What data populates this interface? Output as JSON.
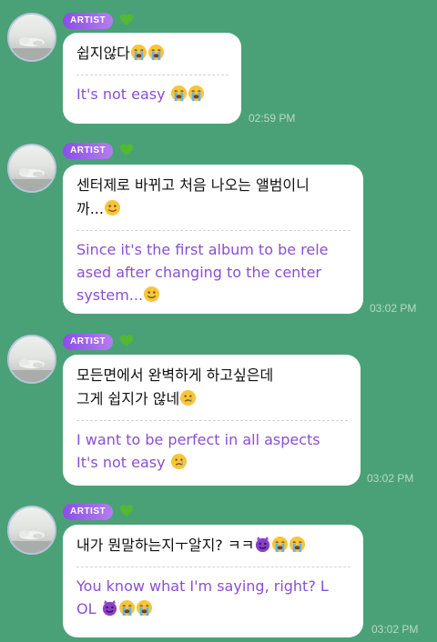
{
  "colors": {
    "background": "#4aa177",
    "bubble": "#ffffff",
    "korean_text": "#111111",
    "english_text": "#8a4fd2",
    "badge_start": "#8a4fe6",
    "badge_end": "#b57cf0",
    "timestamp": "#b9d9c8",
    "heart": "#53b832"
  },
  "messages": [
    {
      "badge": "ARTIST",
      "heart_icon": "green-heart-icon",
      "korean": "쉽지않다",
      "korean_emojis": [
        "loudly-crying-icon",
        "loudly-crying-icon"
      ],
      "english": "It's not easy",
      "english_emojis": [
        "loudly-crying-icon",
        "loudly-crying-icon"
      ],
      "time": "02:59 PM"
    },
    {
      "badge": "ARTIST",
      "heart_icon": "green-heart-icon",
      "korean": "센터제로 바뀌고 처음 나오는 앨범이니\n까...",
      "korean_emojis": [
        "smiling-face-icon"
      ],
      "english": "Since it's the first album to be rele\nased after changing to the center\nsystem...",
      "english_emojis": [
        "smiling-face-icon"
      ],
      "time": "03:02 PM"
    },
    {
      "badge": "ARTIST",
      "heart_icon": "green-heart-icon",
      "korean": "모든면에서 완벽하게 하고싶은데\n그게 쉽지가 않네",
      "korean_emojis": [
        "crying-face-icon"
      ],
      "english": "I want to be perfect in all aspects\nIt's not easy",
      "english_emojis": [
        "crying-face-icon"
      ],
      "time": "03:02 PM"
    },
    {
      "badge": "ARTIST",
      "heart_icon": "green-heart-icon",
      "korean": "내가 뭔말하는지ㅜ알지? ㅋㅋ",
      "korean_emojis": [
        "smiling-devil-icon",
        "loudly-crying-icon",
        "loudly-crying-icon"
      ],
      "english": "You know what I'm saying, right? L\nOL",
      "english_emojis": [
        "smiling-devil-icon",
        "loudly-crying-icon",
        "loudly-crying-icon"
      ],
      "time": "03:02 PM"
    }
  ]
}
